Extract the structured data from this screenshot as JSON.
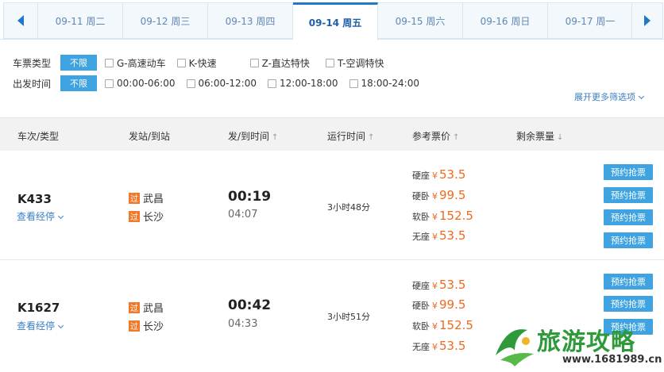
{
  "dates": {
    "prev_icon": "arrow-left-icon",
    "next_icon": "arrow-right-icon",
    "tabs": [
      {
        "label": "09-11 周二"
      },
      {
        "label": "09-12 周三"
      },
      {
        "label": "09-13 周四"
      },
      {
        "label": "09-14 周五",
        "active": true
      },
      {
        "label": "09-15 周六"
      },
      {
        "label": "09-16 周日"
      },
      {
        "label": "09-17 周一"
      }
    ]
  },
  "filters": {
    "type_label": "车票类型",
    "type_any": "不限",
    "type_options": [
      "G-高速动车",
      "K-快速",
      "Z-直达特快",
      "T-空调特快"
    ],
    "time_label": "出发时间",
    "time_any": "不限",
    "time_options": [
      "00:00-06:00",
      "06:00-12:00",
      "12:00-18:00",
      "18:00-24:00"
    ],
    "more": "展开更多筛选项"
  },
  "table_header": {
    "train": "车次/类型",
    "stations": "发站/到站",
    "times": "发/到时间",
    "duration": "运行时间",
    "price": "参考票价",
    "remaining": "剩余票量",
    "sort_up": "↑",
    "sort_down": "↓"
  },
  "trains": [
    {
      "number": "K433",
      "stops_link": "查看经停",
      "pass_mark": "过",
      "from": "武昌",
      "to": "长沙",
      "depart": "00:19",
      "arrive": "04:07",
      "duration": "3小时48分",
      "prices": [
        {
          "seat": "硬座",
          "yen": "¥",
          "amount": "53.5"
        },
        {
          "seat": "硬卧",
          "yen": "¥",
          "amount": "99.5"
        },
        {
          "seat": "软卧",
          "yen": "¥",
          "amount": "152.5"
        },
        {
          "seat": "无座",
          "yen": "¥",
          "amount": "53.5"
        }
      ],
      "buttons": [
        "预约抢票",
        "预约抢票",
        "预约抢票",
        "预约抢票"
      ]
    },
    {
      "number": "K1627",
      "stops_link": "查看经停",
      "pass_mark": "过",
      "from": "武昌",
      "to": "长沙",
      "depart": "00:42",
      "arrive": "04:33",
      "duration": "3小时51分",
      "prices": [
        {
          "seat": "硬座",
          "yen": "¥",
          "amount": "53.5"
        },
        {
          "seat": "硬卧",
          "yen": "¥",
          "amount": "99.5"
        },
        {
          "seat": "软卧",
          "yen": "¥",
          "amount": "152.5"
        },
        {
          "seat": "无座",
          "yen": "¥",
          "amount": "53.5"
        }
      ],
      "buttons": [
        "预约抢票",
        "预约抢票",
        "预约抢票"
      ]
    }
  ],
  "watermark": {
    "text": "旅游攻略",
    "url": "www.1681989.cn",
    "icon": "travel-logo-icon"
  },
  "colors": {
    "accent": "#3ea3e0",
    "price": "#f06a1e",
    "link": "#3b7fc4",
    "pass_badge": "#f07a2a"
  }
}
